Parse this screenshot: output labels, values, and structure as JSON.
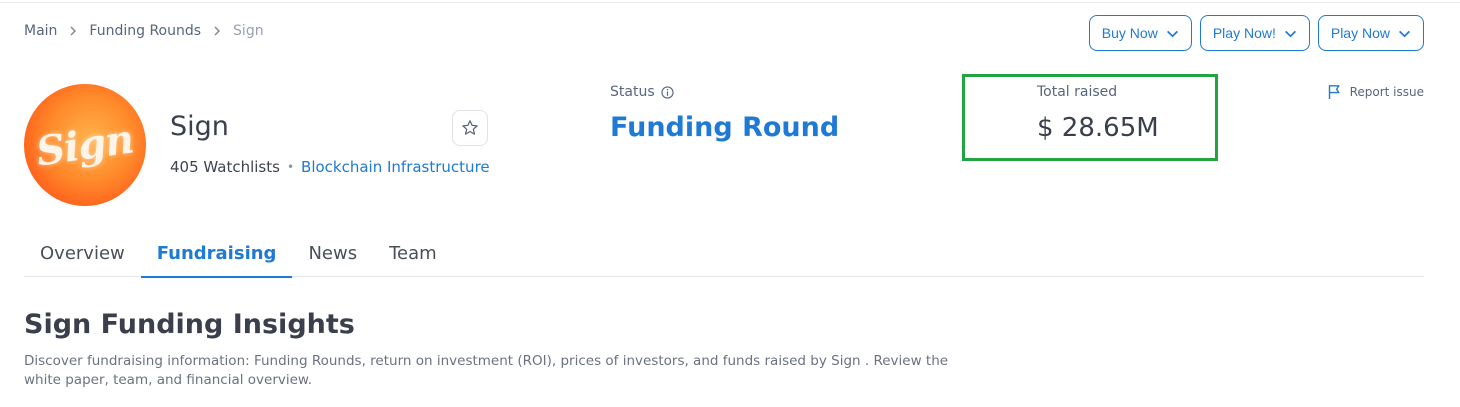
{
  "breadcrumb": {
    "items": [
      "Main",
      "Funding Rounds",
      "Sign"
    ]
  },
  "actions": {
    "buy_now": "Buy Now",
    "play_now_excl": "Play Now!",
    "play_now": "Play Now"
  },
  "project": {
    "logo_text": "Sign",
    "name": "Sign",
    "watchlists": "405 Watchlists",
    "separator": "•",
    "category": "Blockchain Infrastructure"
  },
  "status": {
    "label": "Status",
    "value": "Funding Round"
  },
  "raised": {
    "label": "Total raised",
    "value": "$ 28.65M"
  },
  "report": {
    "label": "Report issue"
  },
  "tabs": [
    "Overview",
    "Fundraising",
    "News",
    "Team"
  ],
  "active_tab": "Fundraising",
  "insights": {
    "title": "Sign Funding Insights",
    "description": "Discover fundraising information: Funding Rounds, return on investment (ROI), prices of investors, and funds raised by Sign . Review the white paper, team, and financial overview."
  },
  "colors": {
    "accent": "#1f7ad6",
    "highlight_box": "#21a441",
    "logo_orange": "#ff8a2a"
  },
  "icons": [
    "chevron-right-icon",
    "chevron-down-icon",
    "star-icon",
    "info-icon",
    "flag-icon"
  ]
}
